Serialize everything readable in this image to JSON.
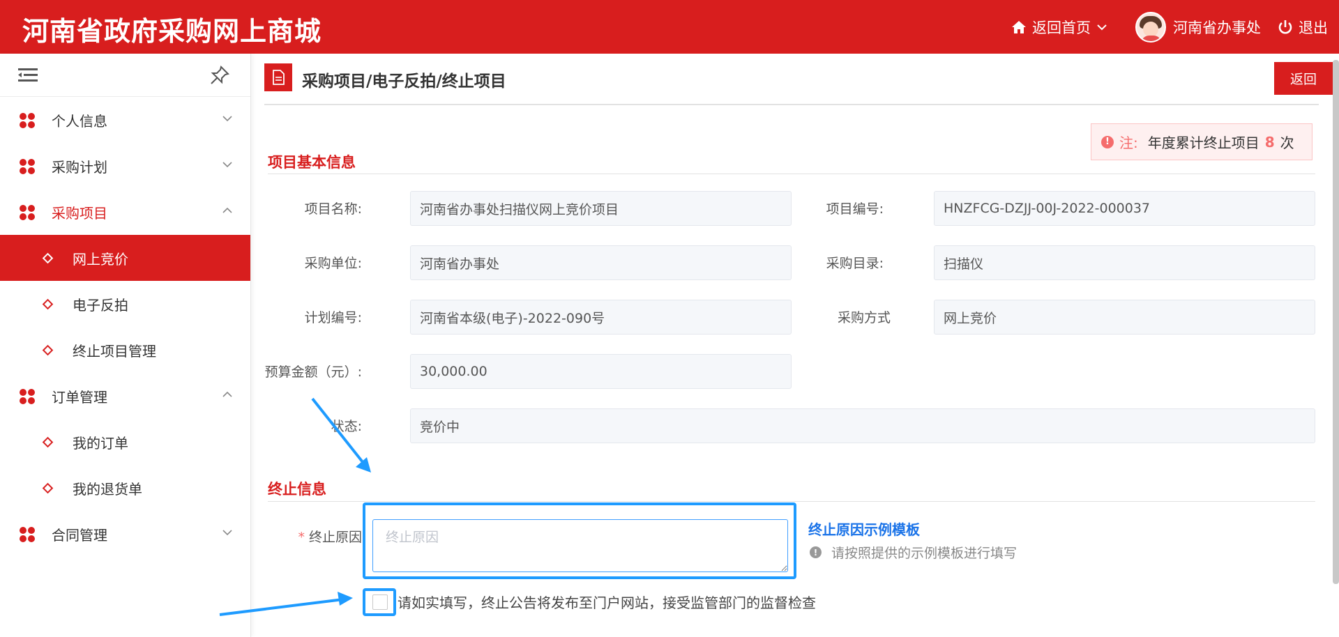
{
  "header": {
    "logo": "河南省政府采购网上商城",
    "home_label": "返回首页",
    "user_name": "河南省办事处",
    "logout_label": "退出"
  },
  "sidebar": {
    "items": [
      {
        "label": "个人信息",
        "chevron": "down"
      },
      {
        "label": "采购计划",
        "chevron": "down"
      },
      {
        "label": "采购项目",
        "chevron": "up"
      },
      {
        "label": "网上竞价"
      },
      {
        "label": "电子反拍"
      },
      {
        "label": "终止项目管理"
      },
      {
        "label": "订单管理",
        "chevron": "up"
      },
      {
        "label": "我的订单"
      },
      {
        "label": "我的退货单"
      },
      {
        "label": "合同管理",
        "chevron": "down"
      }
    ]
  },
  "breadcrumb": "采购项目/电子反拍/终止项目",
  "back_button": "返回",
  "notice": {
    "prefix": "注:",
    "text": "年度累计终止项目",
    "count": "8",
    "suffix": "次"
  },
  "basic_info": {
    "title": "项目基本信息",
    "project_name": {
      "label": "项目名称:",
      "value": "河南省办事处扫描仪网上竞价项目"
    },
    "project_code": {
      "label": "项目编号:",
      "value": "HNZFCG-DZJJ-00J-2022-000037"
    },
    "purchaser": {
      "label": "采购单位:",
      "value": "河南省办事处"
    },
    "catalog": {
      "label": "采购目录:",
      "value": "扫描仪"
    },
    "plan_code": {
      "label": "计划编号:",
      "value": "河南省本级(电子)-2022-090号"
    },
    "method": {
      "label": "采购方式",
      "value": "网上竞价"
    },
    "budget": {
      "label": "预算金额（元）:",
      "value": "30,000.00"
    },
    "status": {
      "label": "状态:",
      "value": "竞价中"
    }
  },
  "termination": {
    "title": "终止信息",
    "reason_required_mark": "*",
    "reason_label": "终止原因",
    "reason_placeholder": "终止原因",
    "reason_value": "",
    "template_link": "终止原因示例模板",
    "template_hint": "请按照提供的示例模板进行填写",
    "confirm_checked": false,
    "confirm_text": "请如实填写，终止公告将发布至门户网站，接受监管部门的监督检查"
  },
  "colors": {
    "brand_red": "#d81e1e",
    "highlight_blue": "#1e9bff",
    "link_blue": "#1a73e8",
    "warn_red": "#f56c6c"
  }
}
